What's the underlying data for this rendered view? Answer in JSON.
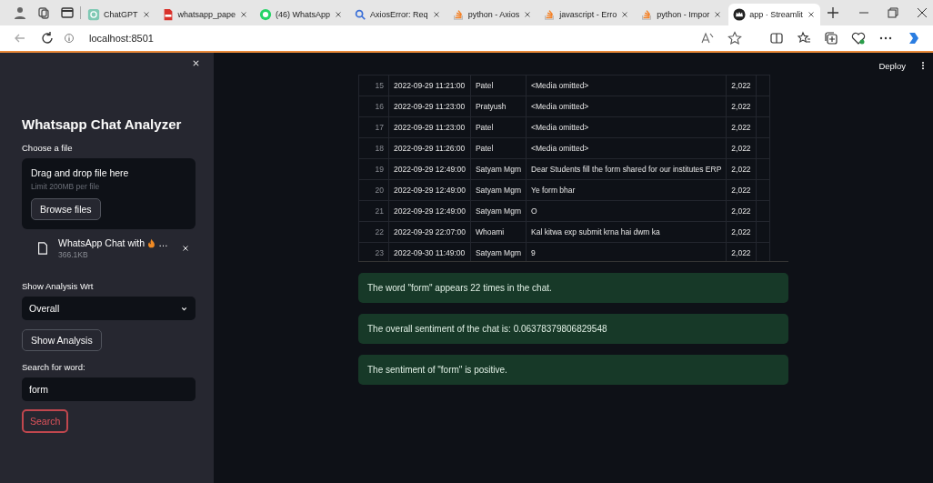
{
  "browser": {
    "tabs": [
      {
        "kind": "chatgpt",
        "title": "ChatGPT",
        "selected": false
      },
      {
        "kind": "pdf",
        "title": "whatsapp_pape",
        "selected": false
      },
      {
        "kind": "whatsapp",
        "title": "(46) WhatsApp",
        "selected": false
      },
      {
        "kind": "search",
        "title": "AxiosError: Req",
        "selected": false
      },
      {
        "kind": "stack",
        "title": "python - Axios",
        "selected": false
      },
      {
        "kind": "stack",
        "title": "javascript - Erro",
        "selected": false
      },
      {
        "kind": "stack",
        "title": "python - Impor",
        "selected": false
      },
      {
        "kind": "streamlit",
        "title": "app · Streamlit",
        "selected": true
      }
    ],
    "address": "localhost:8501"
  },
  "header": {
    "deploy": "Deploy"
  },
  "sidebar": {
    "title": "Whatsapp Chat Analyzer",
    "uploader": {
      "label": "Choose a file",
      "drop_text": "Drag and drop file here",
      "limit": "Limit 200MB per file",
      "browse": "Browse files"
    },
    "file": {
      "name": "WhatsApp Chat with",
      "suffix": "…",
      "size": "366.1KB"
    },
    "select": {
      "label": "Show Analysis Wrt",
      "value": "Overall"
    },
    "show_button": "Show Analysis",
    "search": {
      "label": "Search for word:",
      "value": "form",
      "button": "Search"
    }
  },
  "table": {
    "rows": [
      {
        "index": "15",
        "cells": [
          "2022-09-29 11:21:00",
          "Patel",
          "<Media omitted>",
          "2,022"
        ]
      },
      {
        "index": "16",
        "cells": [
          "2022-09-29 11:23:00",
          "Pratyush",
          "<Media omitted>",
          "2,022"
        ]
      },
      {
        "index": "17",
        "cells": [
          "2022-09-29 11:23:00",
          "Patel",
          "<Media omitted>",
          "2,022"
        ]
      },
      {
        "index": "18",
        "cells": [
          "2022-09-29 11:26:00",
          "Patel",
          "<Media omitted>",
          "2,022"
        ]
      },
      {
        "index": "19",
        "cells": [
          "2022-09-29 12:49:00",
          "Satyam Mgm",
          "Dear Students fill the form shared for our institutes ERP",
          "2,022"
        ]
      },
      {
        "index": "20",
        "cells": [
          "2022-09-29 12:49:00",
          "Satyam Mgm",
          "Ye form bhar",
          "2,022"
        ]
      },
      {
        "index": "21",
        "cells": [
          "2022-09-29 12:49:00",
          "Satyam Mgm",
          "O",
          "2,022"
        ]
      },
      {
        "index": "22",
        "cells": [
          "2022-09-29 22:07:00",
          "Whoami",
          "Kal kitwa exp submit krna hai dwm ka",
          "2,022"
        ]
      },
      {
        "index": "23",
        "cells": [
          "2022-09-30 11:49:00",
          "Satyam Mgm",
          "9",
          "2,022"
        ]
      }
    ]
  },
  "results": [
    "The word \"form\" appears 22 times in the chat.",
    "The overall sentiment of the chat is: 0.06378379806829548",
    "The sentiment of \"form\" is positive."
  ]
}
